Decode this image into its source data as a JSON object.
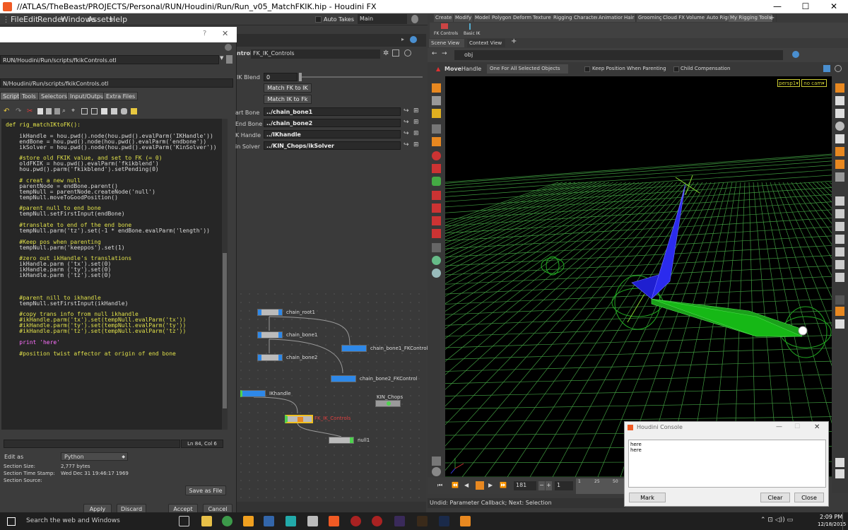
{
  "window": {
    "title": "//ATLAS/TheBeast/PROJECTS/Personal/RUN/Houdini/Run/Run_v05_MatchFKIK.hip - Houdini FX",
    "minimize": "—",
    "maximize": "☐",
    "close": "✕"
  },
  "menu": {
    "items": [
      "File",
      "Edit",
      "Render",
      "Windows",
      "Assets",
      "Help"
    ],
    "auto_takes": "Auto Takes",
    "desk": "Main"
  },
  "shelf": {
    "tabs": [
      "Create",
      "Modify",
      "Model",
      "Polygon",
      "Deform",
      "Texture",
      "Rigging",
      "Character",
      "Animation",
      "Hair",
      "Grooming",
      "Cloud FX",
      "Volume",
      "Auto Rigs",
      "My Rigging Tools"
    ],
    "tools": [
      "FK Controls",
      "Basic IK"
    ]
  },
  "dialog": {
    "help": "?",
    "close": "✕",
    "library_path": "RUN/Houdini/Run/scripts/fkikControls.otl",
    "save_path": "N/Houdini/Run/scripts/fkikControls.otl",
    "tabs": [
      "Scripts",
      "Tools",
      "Selectors",
      "Input/Output",
      "Extra Files"
    ],
    "code": [
      {
        "t": "def rig_matchIKtoFK():",
        "c": "kw"
      },
      {
        "t": "",
        "c": ""
      },
      {
        "t": "    ikHandle = hou.pwd().node(hou.pwd().evalParm('IKHandle'))",
        "c": ""
      },
      {
        "t": "    endBone = hou.pwd().node(hou.pwd().evalParm('endbone'))",
        "c": ""
      },
      {
        "t": "    ikSolver = hou.pwd().node(hou.pwd().evalParm('KinSolver'))",
        "c": ""
      },
      {
        "t": "",
        "c": ""
      },
      {
        "t": "    #store old FKIK value, and set to FK (= 0)",
        "c": "cm"
      },
      {
        "t": "    oldFKIK = hou.pwd().evalParm('fkikblend')",
        "c": ""
      },
      {
        "t": "    hou.pwd().parm('fkikblend').setPending(0)",
        "c": ""
      },
      {
        "t": "",
        "c": ""
      },
      {
        "t": "    # creat a new null",
        "c": "cm"
      },
      {
        "t": "    parentNode = endBone.parent()",
        "c": ""
      },
      {
        "t": "    tempNull = parentNode.createNode('null')",
        "c": ""
      },
      {
        "t": "    tempNull.moveToGoodPosition()",
        "c": ""
      },
      {
        "t": "",
        "c": ""
      },
      {
        "t": "    #parent null to end bone",
        "c": "cm"
      },
      {
        "t": "    tempNull.setFirstInput(endBone)",
        "c": ""
      },
      {
        "t": "",
        "c": ""
      },
      {
        "t": "    #translate to end of the end bone",
        "c": "cm"
      },
      {
        "t": "    tempNull.parm('tz').set(-1 * endBone.evalParm('length'))",
        "c": ""
      },
      {
        "t": "",
        "c": ""
      },
      {
        "t": "    #Keep pos when parenting",
        "c": "cm"
      },
      {
        "t": "    tempNull.parm('keeppos').set(1)",
        "c": ""
      },
      {
        "t": "",
        "c": ""
      },
      {
        "t": "    #zero out ikHandle's translations",
        "c": "cm"
      },
      {
        "t": "    ikHandle.parm ('tx').set(0)",
        "c": ""
      },
      {
        "t": "    ikHandle.parm ('ty').set(0)",
        "c": ""
      },
      {
        "t": "    ikHandle.parm ('tz').set(0)",
        "c": ""
      },
      {
        "t": "",
        "c": ""
      },
      {
        "t": "",
        "c": ""
      },
      {
        "t": "",
        "c": ""
      },
      {
        "t": "    #parent nill to ikhandle",
        "c": "cm"
      },
      {
        "t": "    tempNull.setFirstInput(ikHandle)",
        "c": ""
      },
      {
        "t": "",
        "c": ""
      },
      {
        "t": "    #copy trans info from null ikhandle",
        "c": "cm"
      },
      {
        "t": "    #ikHandle.parm('tx').set(tempNull.evalParm('tx'))",
        "c": "cm"
      },
      {
        "t": "    #ikHandle.parm('ty').set(tempNull.evalParm('ty'))",
        "c": "cm"
      },
      {
        "t": "    #ikHandle.parm('tz').set(tempNull.evalParm('tz'))",
        "c": "cm"
      },
      {
        "t": "",
        "c": ""
      },
      {
        "t": "    print 'here'",
        "c": "pr"
      },
      {
        "t": "",
        "c": ""
      },
      {
        "t": "    #position twist affector at origin of end bone",
        "c": "cm"
      }
    ],
    "cursor_pos": "Ln 84, Col 6",
    "edit_as_label": "Edit as",
    "edit_as_value": "Python",
    "section_size_label": "Section Size:",
    "section_size": "2,777 bytes",
    "section_time_label": "Section Time Stamp:",
    "section_time": "Wed Dec 31 19:46:17 1969",
    "section_source_label": "Section Source:",
    "save_as_file": "Save as File",
    "apply": "Apply",
    "discard": "Discard",
    "accept": "Accept",
    "cancel": "Cancel"
  },
  "parms": {
    "node_type": "ntrols",
    "node_name": "FK_IK_Controls",
    "ik_blend_label": "IK Blend",
    "ik_blend_value": "0",
    "match_fk_to_ik": "Match FK to IK",
    "match_ik_to_fk": "Match IK to Fk",
    "start_bone_label": "art Bone",
    "start_bone": "../chain_bone1",
    "end_bone_label": "End Bone",
    "end_bone": "../chain_bone2",
    "ik_handle_label": "K Handle",
    "ik_handle": "../IKhandle",
    "kin_solver_label": "in Solver",
    "kin_solver": "../KIN_Chops/ikSolver"
  },
  "network": {
    "nodes": [
      {
        "name": "chain_root1"
      },
      {
        "name": "chain_bone1"
      },
      {
        "name": "chain_bone2"
      },
      {
        "name": "chain_bone1_FKControl"
      },
      {
        "name": "chain_bone2_FKControl"
      },
      {
        "name": "IKhandle"
      },
      {
        "name": "KIN_Chops"
      },
      {
        "name": "FK_IK_Controls"
      },
      {
        "name": "null1"
      }
    ]
  },
  "viewer": {
    "tabs": [
      "Scene View",
      "Context View"
    ],
    "path": "obj",
    "move_label": "Move",
    "handle_label": "Handle",
    "handle_mode": "One For All Selected Objects",
    "keep_pos": "Keep Position When Parenting",
    "child_comp": "Child Compensation",
    "camera": "persp1▾",
    "cam2": "no cam▾"
  },
  "timeline": {
    "frame": "181",
    "start": "1",
    "tick1": "1",
    "tick25": "25",
    "tick50": "50",
    "status": "Undid: Parameter Callback; Next: Selection"
  },
  "console": {
    "title": "Houdini Console",
    "lines": [
      "here",
      "here"
    ],
    "mark": "Mark",
    "clear": "Clear",
    "close": "Close"
  },
  "taskbar": {
    "search": "Search the web and Windows",
    "time": "2:09 PM",
    "date": "12/18/2015"
  }
}
